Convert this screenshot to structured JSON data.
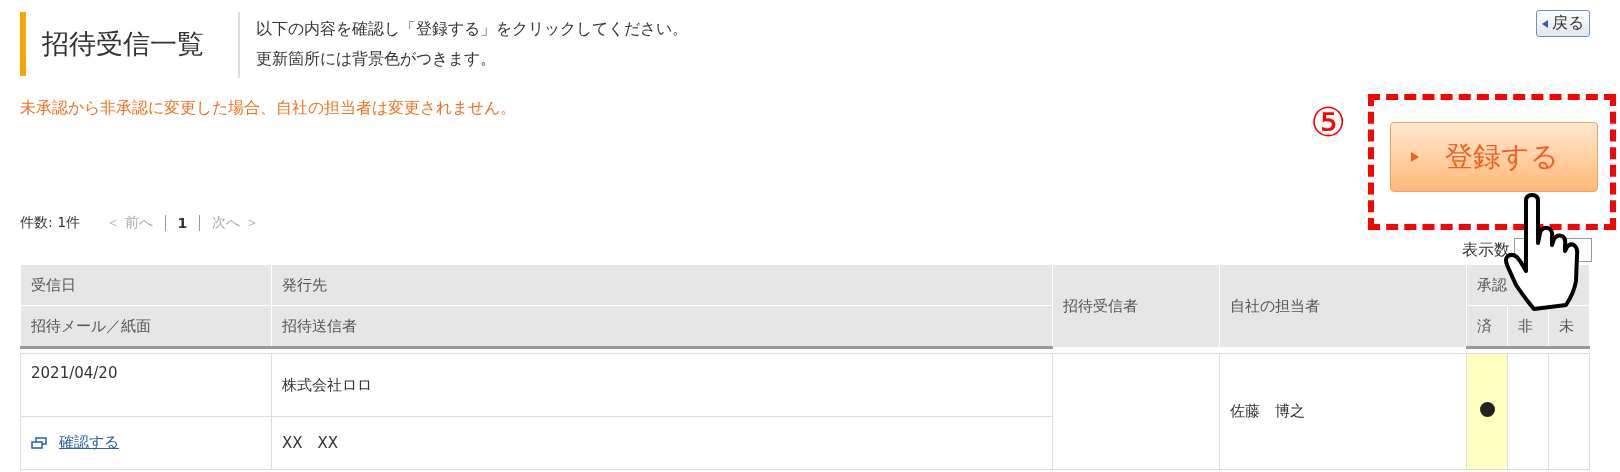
{
  "header": {
    "title": "招待受信一覧",
    "description": [
      "以下の内容を確認し「登録する」をクリックしてください。",
      "更新箇所には背景色がつきます。"
    ],
    "back_button": "戻る"
  },
  "notice": "未承認から非承認に変更した場合、自社の担当者は変更されません。",
  "step_marker": "⑤",
  "register_button": "登録する",
  "pagination": {
    "count": "件数: 1件",
    "prev": {
      "label": "＜ 前へ",
      "disabled": true
    },
    "pages": [
      {
        "label": "1",
        "selected": true
      }
    ],
    "next": {
      "label": "次へ ＞",
      "disabled": true
    }
  },
  "display_count": {
    "label": "表示数"
  },
  "table": {
    "header_top": [
      "受信日",
      "発行先"
    ],
    "header_bottom": [
      "招待メール／紙面",
      "招待送信者"
    ],
    "invitee_header": "招待受信者",
    "owner_header": "自社の担当者",
    "approval_header": "承認",
    "approval_columns": [
      "済",
      "非",
      "未"
    ],
    "rows": [
      {
        "date": "2021/04/20",
        "issuer": "株式会社ロロ",
        "link": "確認する",
        "sender": "XX　XX",
        "invitee": "",
        "owner": "佐藤　博之",
        "approval": [
          {
            "selected": true
          },
          {
            "selected": false
          },
          {
            "selected": false
          }
        ]
      }
    ]
  }
}
